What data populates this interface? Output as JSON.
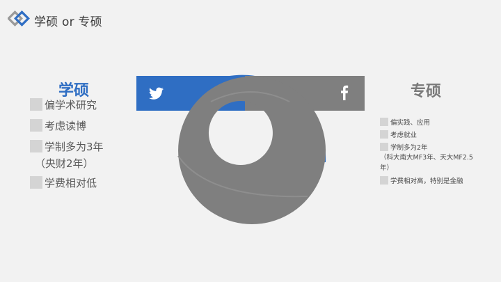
{
  "header": {
    "title": "学硕 or 专硕"
  },
  "left": {
    "title": "学硕",
    "items": [
      {
        "text": "偏学术研究"
      },
      {
        "text": "考虑读博"
      },
      {
        "text": "学制多为3年"
      },
      {
        "text": "学费相对低"
      }
    ],
    "note": "（央财2年）"
  },
  "right": {
    "title": "专硕",
    "items": [
      {
        "text": "偏实践、应用"
      },
      {
        "text": "考虑就业"
      },
      {
        "text": "学制多为2年"
      },
      {
        "text": "学费相对高，特别是金融"
      }
    ],
    "note": "（科大南大MF3年、天大MF2.5年）"
  },
  "colors": {
    "blue": "#2f6ec3",
    "gray": "#7f7f7f",
    "background": "#f2f2f2"
  },
  "icons": {
    "left_banner": "twitter-icon",
    "right_banner": "facebook-icon",
    "logo": "diamond-logo-icon"
  }
}
